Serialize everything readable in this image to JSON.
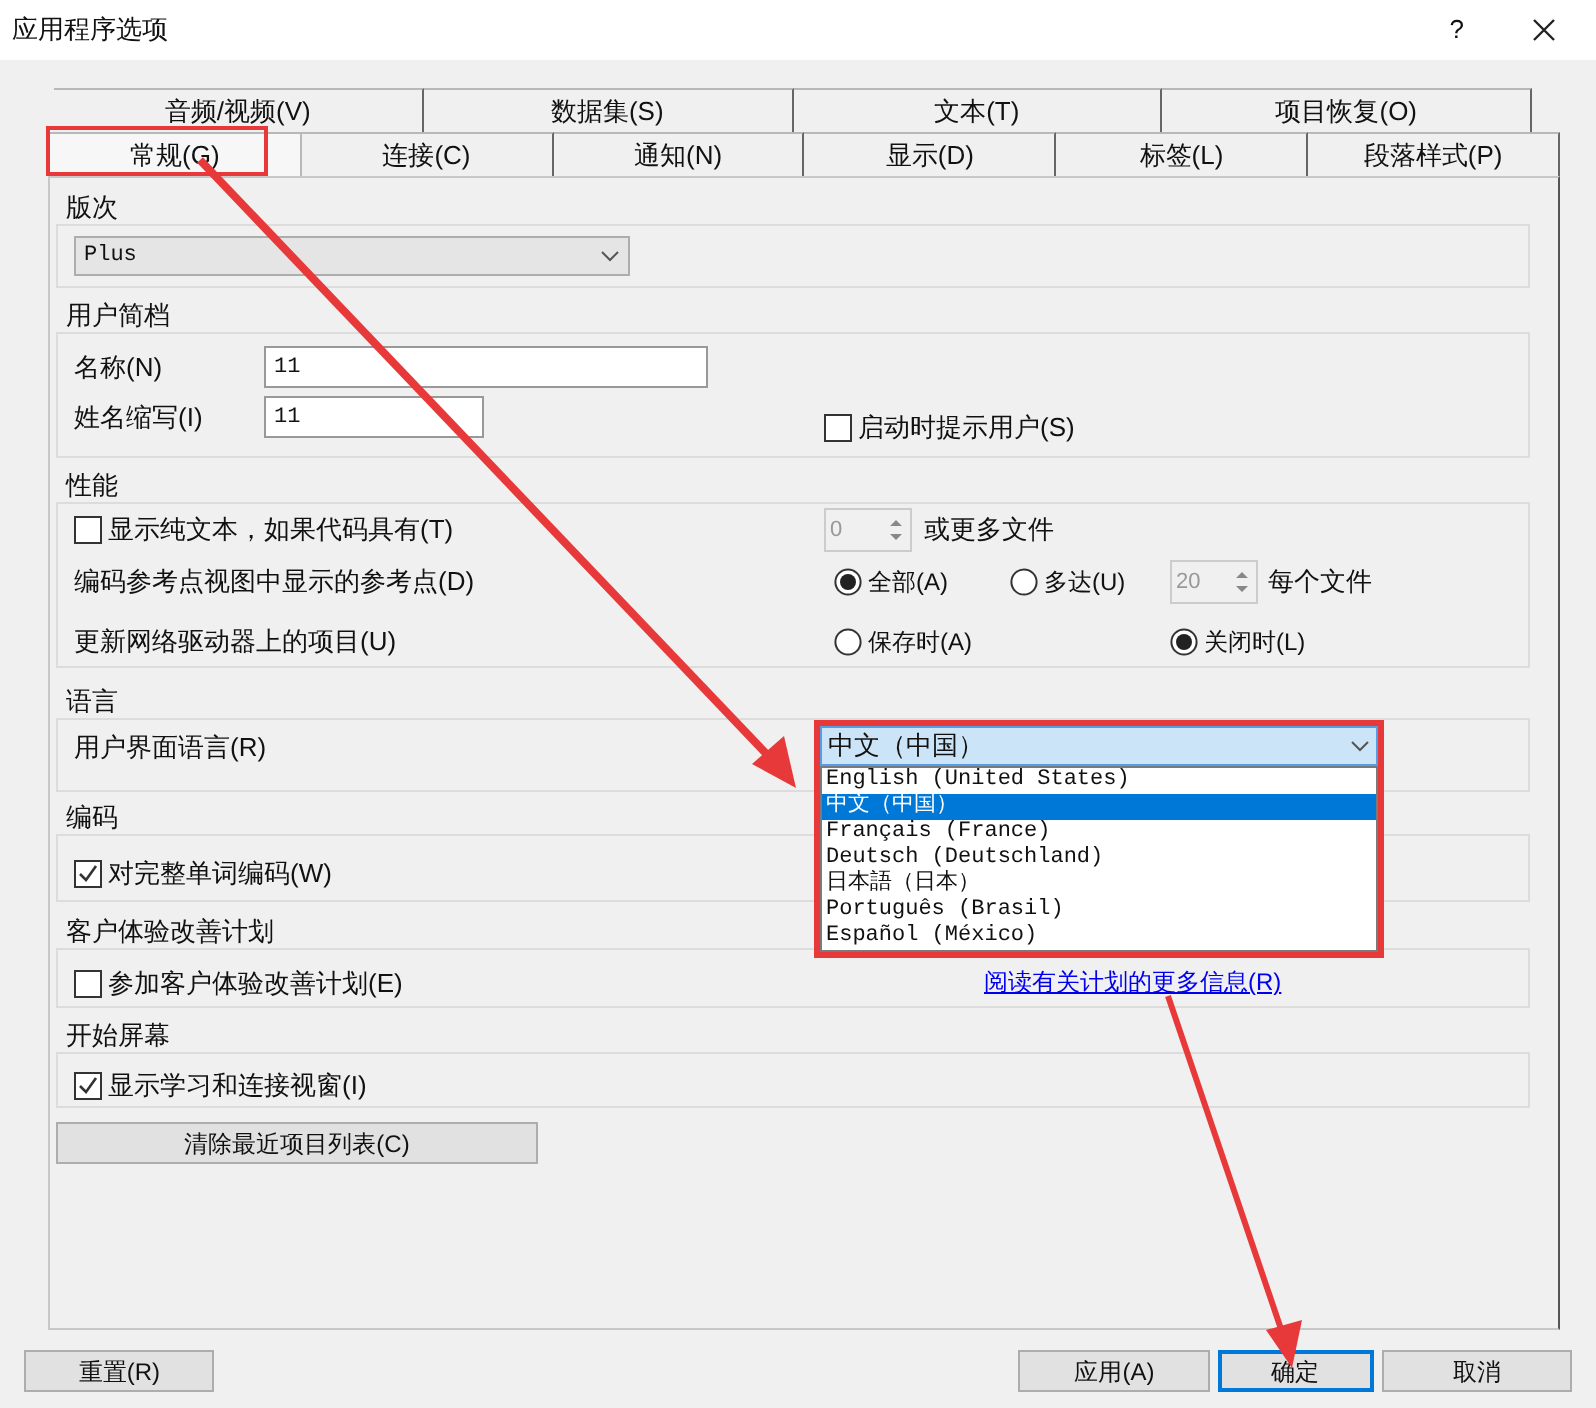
{
  "window": {
    "title": "应用程序选项",
    "help": "?"
  },
  "tab_rows": [
    {
      "tabs": [
        {
          "label": "音频/视频(V)",
          "selected": false
        },
        {
          "label": "数据集(S)",
          "selected": false
        },
        {
          "label": "文本(T)",
          "selected": false
        },
        {
          "label": "项目恢复(O)",
          "selected": false
        }
      ]
    },
    {
      "tabs": [
        {
          "label": "常规(G)",
          "selected": true
        },
        {
          "label": "连接(C)",
          "selected": false
        },
        {
          "label": "通知(N)",
          "selected": false
        },
        {
          "label": "显示(D)",
          "selected": false
        },
        {
          "label": "标签(L)",
          "selected": false
        },
        {
          "label": "段落样式(P)",
          "selected": false
        }
      ]
    }
  ],
  "edition": {
    "title": "版次",
    "value": "Plus"
  },
  "user_profile": {
    "title": "用户简档",
    "fields": [
      {
        "label": "名称(N)",
        "value": "11"
      },
      {
        "label": "姓名缩写(I)",
        "value": "11"
      }
    ],
    "prompt": {
      "label": "启动时提示用户(S)",
      "checked": false
    }
  },
  "performance": {
    "title": "性能",
    "plain_text": {
      "label": "显示纯文本，如果代码具有(T)",
      "checked": false
    },
    "file_spinner": {
      "value": "0",
      "disabled": true,
      "suffix": "或更多文件"
    },
    "ref_points": {
      "label": "编码参考点视图中显示的参考点(D)",
      "options": [
        {
          "label": "全部(A)",
          "selected": true
        },
        {
          "label": "多达(U)",
          "selected": false
        }
      ],
      "spinner": {
        "value": "20",
        "disabled": true
      },
      "suffix": "每个文件"
    },
    "network": {
      "label": "更新网络驱动器上的项目(U)",
      "options": [
        {
          "label": "保存时(A)",
          "selected": false
        },
        {
          "label": "关闭时(L)",
          "selected": true
        }
      ]
    }
  },
  "language": {
    "title": "语言",
    "label": "用户界面语言(R)",
    "value": "中文（中国）",
    "options": [
      {
        "label": "English (United States)",
        "selected": false
      },
      {
        "label": "中文（中国）",
        "selected": true
      },
      {
        "label": "Français (France)",
        "selected": false
      },
      {
        "label": "Deutsch (Deutschland)",
        "selected": false
      },
      {
        "label": "日本語（日本）",
        "selected": false
      },
      {
        "label": "Português (Brasil)",
        "selected": false
      },
      {
        "label": "Español (México)",
        "selected": false
      }
    ]
  },
  "encoding": {
    "title": "编码",
    "checkbox": {
      "label": "对完整单词编码(W)",
      "checked": true
    }
  },
  "ceip": {
    "title": "客户体验改善计划",
    "checkbox": {
      "label": "参加客户体验改善计划(E)",
      "checked": false
    },
    "link": "阅读有关计划的更多信息(R)"
  },
  "start_screen": {
    "title": "开始屏幕",
    "checkbox": {
      "label": "显示学习和连接视窗(I)",
      "checked": true
    }
  },
  "clear_button": "清除最近项目列表(C)",
  "buttons": [
    {
      "label": "重置(R)",
      "default": false
    },
    {
      "label": "应用(A)",
      "default": false
    },
    {
      "label": "确定",
      "default": true
    },
    {
      "label": "取消",
      "default": false
    }
  ]
}
